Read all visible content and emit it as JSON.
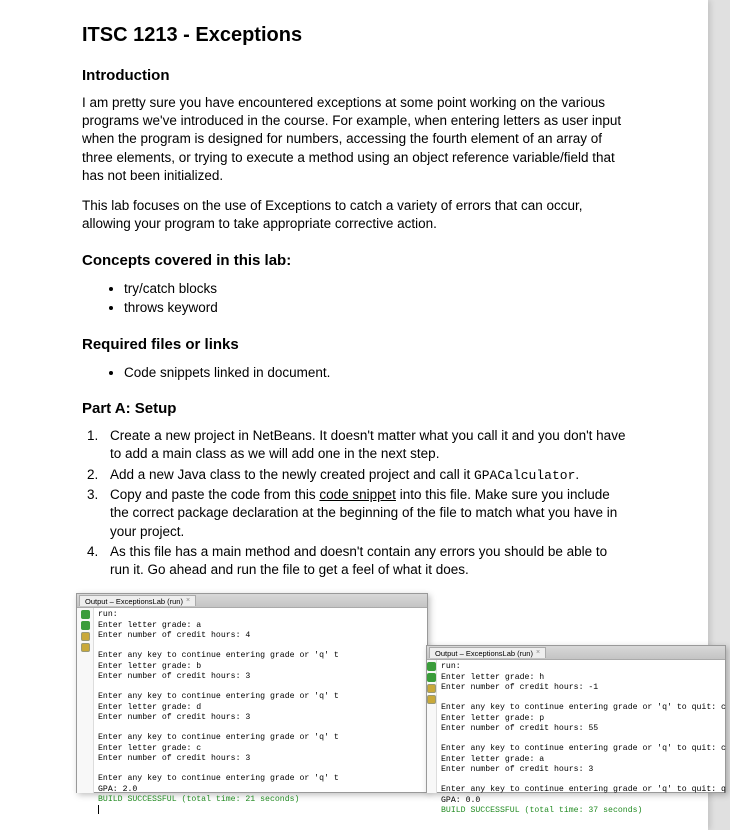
{
  "title": "ITSC 1213 - Exceptions",
  "sections": {
    "intro_heading": "Introduction",
    "intro_p1": "I am pretty sure you have encountered exceptions at some point working on the various programs we've introduced in the course.  For example, when entering letters as user input when the program is designed for numbers, accessing the fourth element of an array of three elements, or trying to execute a method using an object reference variable/field that has not been initialized.",
    "intro_p2": "This lab focuses on the use of Exceptions to catch a variety of errors that can occur, allowing your program to take appropriate corrective action.",
    "concepts_heading": "Concepts covered in this lab:",
    "concepts": [
      "try/catch blocks",
      "throws keyword"
    ],
    "required_heading": "Required files or links",
    "required": [
      "Code snippets linked in document."
    ],
    "partA_heading": "Part A: Setup",
    "steps": {
      "s1": "Create a new project in NetBeans. It doesn't matter what you call it and you don't have to add a main class as we will add one in the next step.",
      "s2a": "Add a new Java class to the newly created project and call it ",
      "s2b": "GPACalculator",
      "s2c": ".",
      "s3a": "Copy and paste the code from this ",
      "s3b": "code snippet",
      "s3c": " into this file. Make sure you include the correct package declaration at the beginning of the file to match what you have in your project.",
      "s4": "As this file has a main method and doesn't contain any errors you should be able to run it. Go ahead and run the file to get a feel of what it does."
    }
  },
  "ide1": {
    "tab": "Output – ExceptionsLab (run)",
    "lines_a": "run:\nEnter letter grade: a\nEnter number of credit hours: 4\n\nEnter any key to continue entering grade or 'q' t\nEnter letter grade: b\nEnter number of credit hours: 3\n\nEnter any key to continue entering grade or 'q' t\nEnter letter grade: d\nEnter number of credit hours: 3\n\nEnter any key to continue entering grade or 'q' t\nEnter letter grade: c\nEnter number of credit hours: 3\n\nEnter any key to continue entering grade or 'q' t\nGPA: 2.0",
    "lines_b": "BUILD SUCCESSFUL (total time: 21 seconds)"
  },
  "ide2": {
    "tab": "Output – ExceptionsLab (run)",
    "lines_a": "run:\nEnter letter grade: h\nEnter number of credit hours: -1\n\nEnter any key to continue entering grade or 'q' to quit: c\nEnter letter grade: p\nEnter number of credit hours: 55\n\nEnter any key to continue entering grade or 'q' to quit: c\nEnter letter grade: a\nEnter number of credit hours: 3\n\nEnter any key to continue entering grade or 'q' to quit: q\nGPA: 0.0",
    "lines_b": "BUILD SUCCESSFUL (total time: 37 seconds)"
  }
}
